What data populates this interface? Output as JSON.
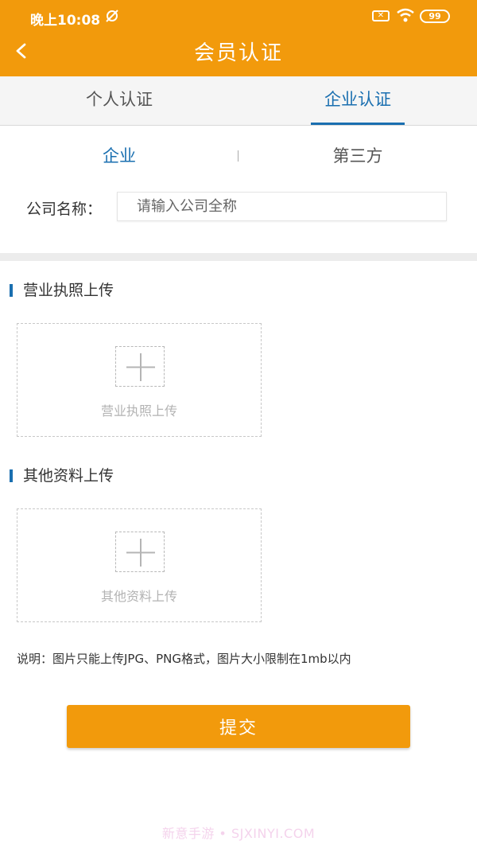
{
  "status_bar": {
    "time": "晚上10:08",
    "mute_icon": "alarm-off-icon",
    "sim_icon": "no-sim-icon",
    "wifi_icon": "wifi-icon",
    "battery": "99"
  },
  "header": {
    "title": "会员认证",
    "back_icon": "chevron-left-icon",
    "background": "#f29a0c"
  },
  "tabs": [
    {
      "label": "个人认证",
      "active": false
    },
    {
      "label": "企业认证",
      "active": true
    }
  ],
  "subtabs": [
    {
      "label": "企业",
      "active": true
    },
    {
      "label": "第三方",
      "active": false
    }
  ],
  "form": {
    "company_label": "公司名称：",
    "company_placeholder": "请输入公司全称",
    "company_value": ""
  },
  "sections": [
    {
      "title": "营业执照上传",
      "upload_text": "营业执照上传",
      "icon": "plus-icon"
    },
    {
      "title": "其他资料上传",
      "upload_text": "其他资料上传",
      "icon": "plus-icon"
    }
  ],
  "note": "说明：图片只能上传JPG、PNG格式，图片大小限制在1mb以内",
  "submit_label": "提交",
  "watermark": "新意手游 • SJXINYI.COM",
  "colors": {
    "accent": "#f29a0c",
    "active_tab": "#1a6fb0"
  }
}
